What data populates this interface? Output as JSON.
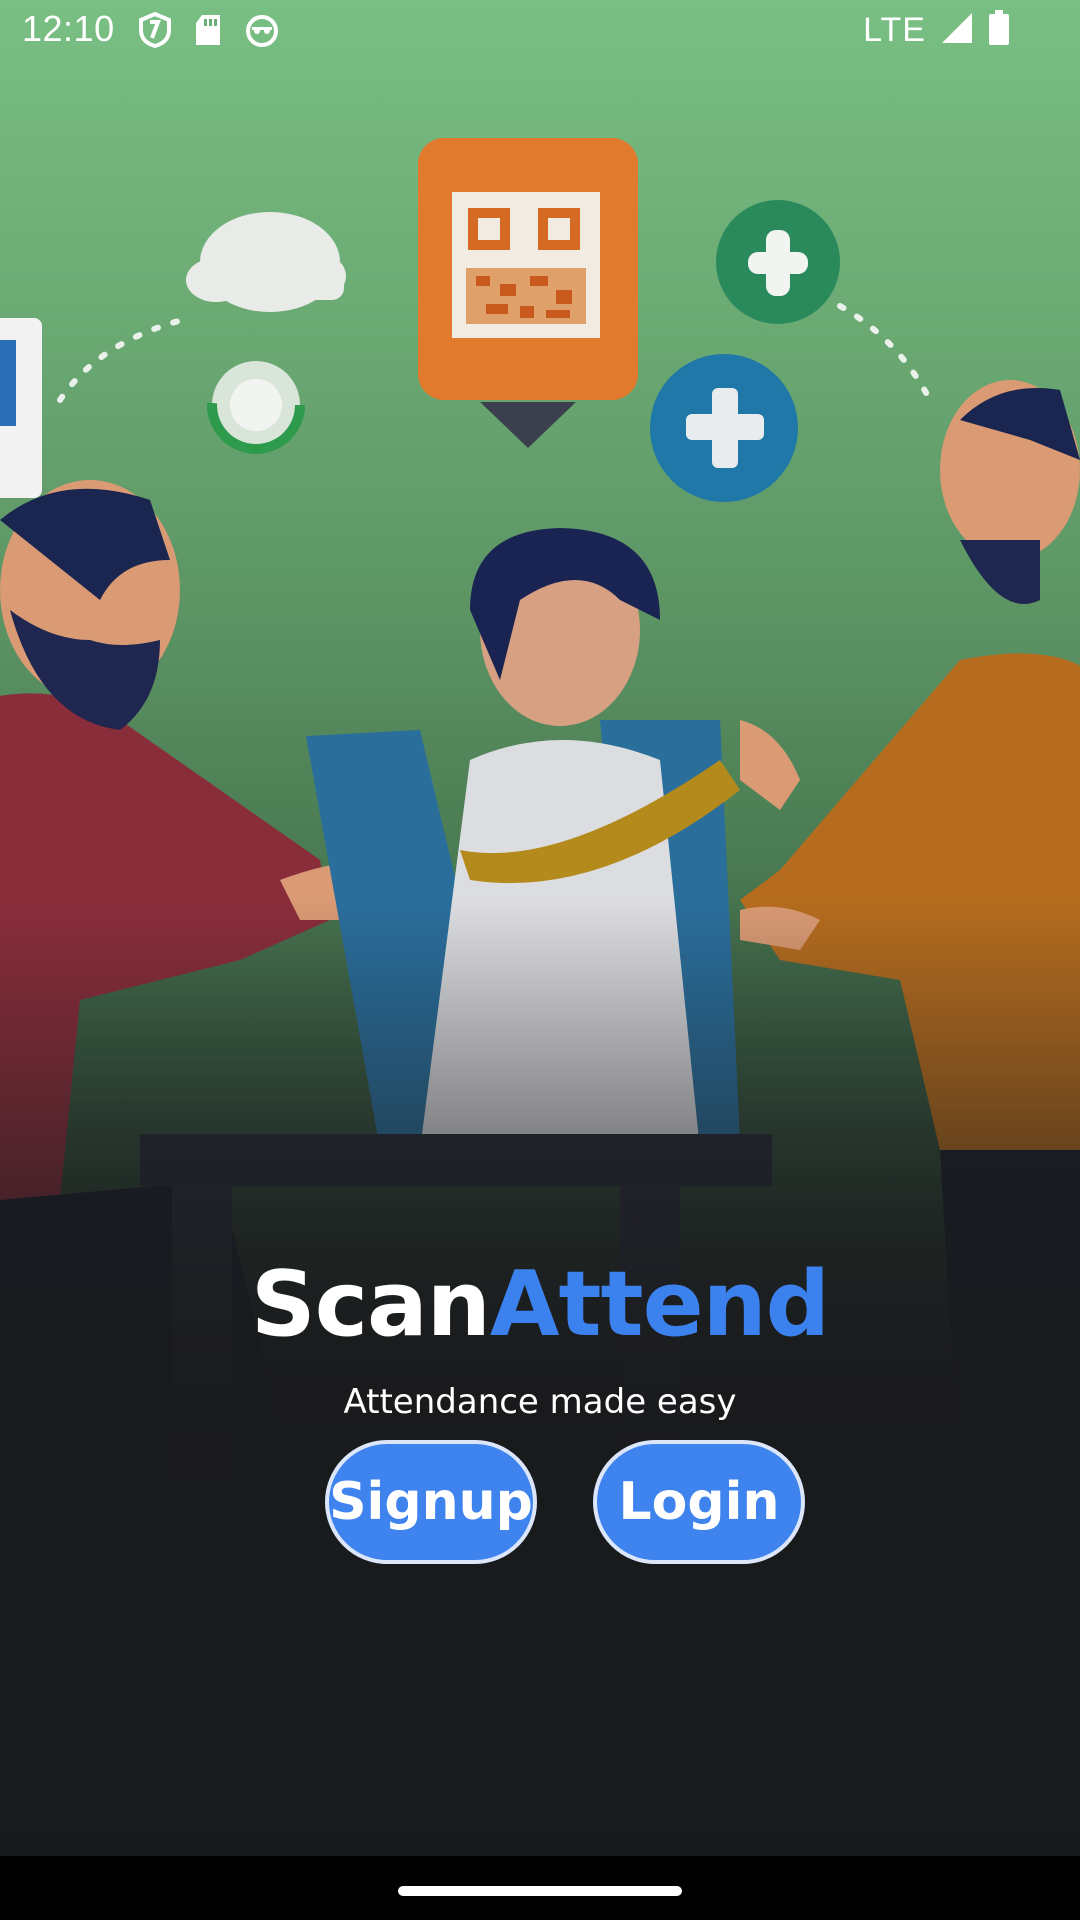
{
  "status_bar": {
    "time": "12:10",
    "network": "LTE",
    "icons_left": [
      "shield-icon",
      "sd-card-icon",
      "android-head-icon"
    ],
    "icons_right": [
      "signal-icon",
      "battery-icon"
    ]
  },
  "brand": {
    "name_part1": "Scan",
    "name_part2": "Attend",
    "accent_color": "#3c82ef"
  },
  "tagline": "Attendance made easy",
  "buttons": {
    "signup_label": "Signup",
    "login_label": "Login",
    "color": "#3f83ef"
  },
  "background": {
    "top_color": "#79bf83",
    "bottom_color": "#18191b"
  }
}
